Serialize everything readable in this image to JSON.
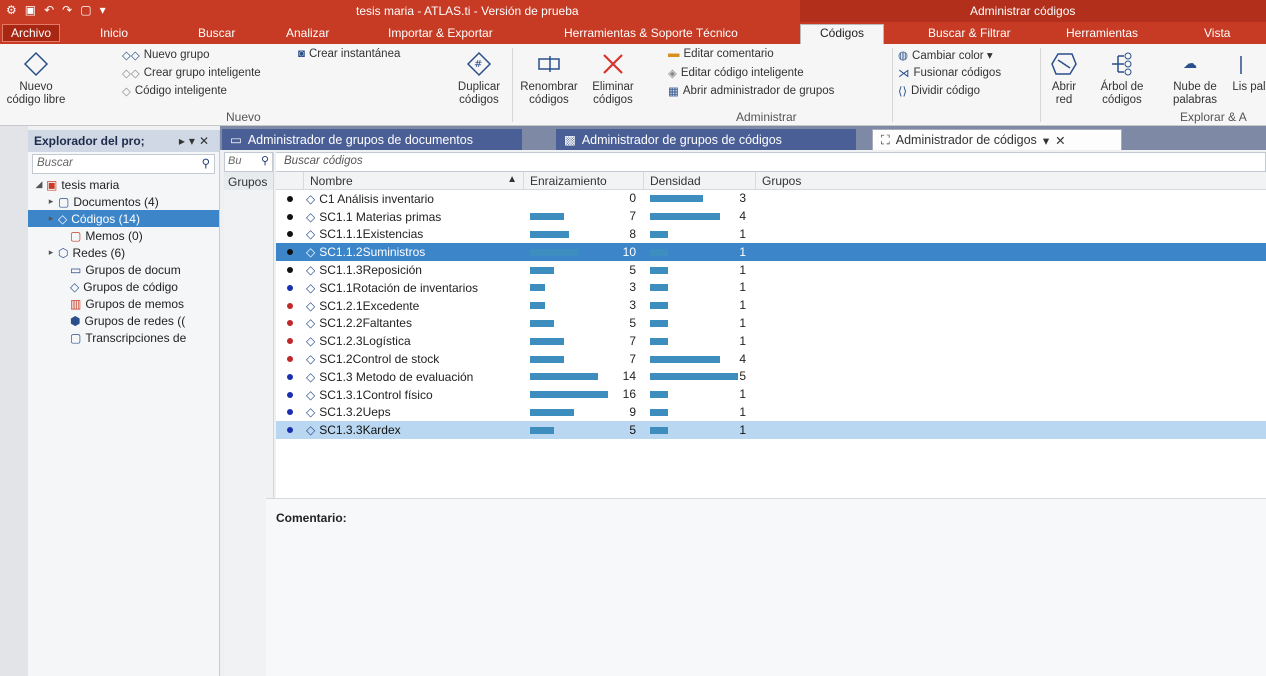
{
  "window": {
    "title": "tesis maria - ATLAS.ti - Versión de prueba",
    "context_title": "Administrar códigos"
  },
  "ribbon_tabs": [
    "Archivo",
    "Inicio",
    "Buscar",
    "Analizar",
    "Importar & Exportar",
    "Herramientas & Soporte Técnico",
    "Códigos",
    "Buscar & Filtrar",
    "Herramientas",
    "Vista"
  ],
  "ribbon": {
    "nuevo": {
      "nuevo_codigo_libre": "Nuevo código libre",
      "nuevo_grupo": "Nuevo grupo",
      "crear_grupo_inteligente": "Crear grupo inteligente",
      "codigo_inteligente": "Código inteligente",
      "crear_instantanea": "Crear instantánea",
      "duplicar_codigos": "Duplicar códigos",
      "group_label": "Nuevo"
    },
    "administrar": {
      "renombrar_codigos": "Renombrar códigos",
      "eliminar_codigos": "Eliminar códigos",
      "editar_comentario": "Editar comentario",
      "editar_codigo_inteligente": "Editar código inteligente",
      "abrir_admin_grupos": "Abrir administrador de grupos",
      "cambiar_color": "Cambiar color ▾",
      "fusionar_codigos": "Fusionar códigos",
      "dividir_codigo": "Dividir código",
      "group_label": "Administrar"
    },
    "explorar": {
      "abrir_red": "Abrir red",
      "arbol_codigos": "Árbol de códigos",
      "nube_palabras": "Nube de palabras",
      "lista_truncated": "Lis pal",
      "group_label": "Explorar & A"
    }
  },
  "explorer": {
    "title": "Explorador del pro;",
    "search_placeholder": "Buscar",
    "tree": [
      {
        "label": "tesis maria",
        "icon": "project-icon"
      },
      {
        "label": "Documentos (4)",
        "icon": "document-icon"
      },
      {
        "label": "Códigos (14)",
        "icon": "code-icon",
        "selected": true
      },
      {
        "label": "Memos (0)",
        "icon": "memo-icon"
      },
      {
        "label": "Redes (6)",
        "icon": "network-icon"
      },
      {
        "label": "Grupos de docum",
        "icon": "document-group-icon"
      },
      {
        "label": "Grupos de código",
        "icon": "code-group-icon"
      },
      {
        "label": "Grupos de memos",
        "icon": "memo-group-icon"
      },
      {
        "label": "Grupos de redes ((",
        "icon": "network-group-icon"
      },
      {
        "label": "Transcripciones de",
        "icon": "transcription-icon"
      }
    ]
  },
  "doc_tabs": [
    {
      "label": "Administrador de grupos de documentos",
      "active": false
    },
    {
      "label": "Administrador de grupos de códigos",
      "active": false
    },
    {
      "label": "Administrador de códigos",
      "active": true
    }
  ],
  "groups_panel": {
    "search_placeholder": "Bu",
    "label": "Grupos"
  },
  "code_table": {
    "search_placeholder": "Buscar códigos",
    "columns": [
      "Nombre",
      "Enraizamiento",
      "Densidad",
      "Grupos"
    ],
    "rows": [
      {
        "name": "C1 Análisis inventario",
        "groundedness": 0,
        "density": 3,
        "dot": "#111111"
      },
      {
        "name": "SC1.1  Materias primas",
        "groundedness": 7,
        "density": 4,
        "dot": "#111111"
      },
      {
        "name": "SC1.1.1Existencias",
        "groundedness": 8,
        "density": 1,
        "dot": "#111111"
      },
      {
        "name": "SC1.1.2Suministros",
        "groundedness": 10,
        "density": 1,
        "dot": "#111111",
        "state": "selected"
      },
      {
        "name": "SC1.1.3Reposición",
        "groundedness": 5,
        "density": 1,
        "dot": "#111111"
      },
      {
        "name": "SC1.1Rotación de inventarios",
        "groundedness": 3,
        "density": 1,
        "dot": "#1a2fb0"
      },
      {
        "name": "SC1.2.1Excedente",
        "groundedness": 3,
        "density": 1,
        "dot": "#c0282a"
      },
      {
        "name": "SC1.2.2Faltantes",
        "groundedness": 5,
        "density": 1,
        "dot": "#c0282a"
      },
      {
        "name": "SC1.2.3Logística",
        "groundedness": 7,
        "density": 1,
        "dot": "#c0282a"
      },
      {
        "name": "SC1.2Control de stock",
        "groundedness": 7,
        "density": 4,
        "dot": "#c0282a"
      },
      {
        "name": "SC1.3 Metodo de evaluación",
        "groundedness": 14,
        "density": 5,
        "dot": "#1a2fb0"
      },
      {
        "name": "SC1.3.1Control físico",
        "groundedness": 16,
        "density": 1,
        "dot": "#1a2fb0"
      },
      {
        "name": "SC1.3.2Ueps",
        "groundedness": 9,
        "density": 1,
        "dot": "#1a2fb0"
      },
      {
        "name": "SC1.3.3Kardex",
        "groundedness": 5,
        "density": 1,
        "dot": "#1a2fb0",
        "state": "highlighted"
      }
    ]
  },
  "comment": {
    "label": "Comentario:"
  },
  "colors": {
    "brand": "#c73a24",
    "selection": "#3d85c9",
    "bar": "#3d8dbf"
  }
}
